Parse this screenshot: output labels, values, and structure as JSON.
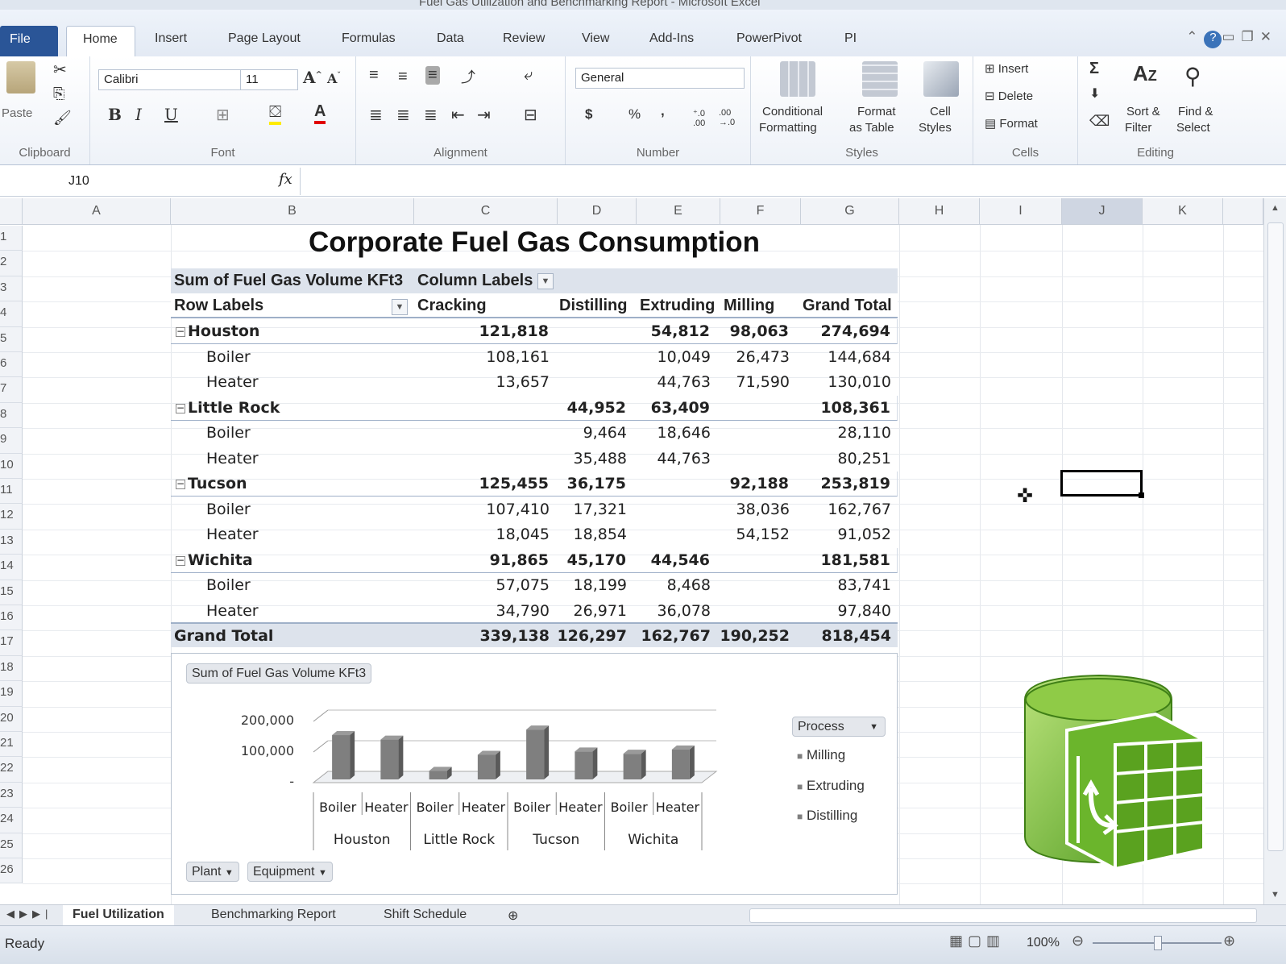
{
  "window": {
    "title": "Fuel Gas Utilization and Benchmarking Report - Microsoft Excel"
  },
  "ribbon_tabs": [
    "File",
    "Home",
    "Insert",
    "Page Layout",
    "Formulas",
    "Data",
    "Review",
    "View",
    "Add-Ins",
    "PowerPivot",
    "PI"
  ],
  "ribbon": {
    "clipboard": {
      "paste": "Paste",
      "label": "Clipboard"
    },
    "font": {
      "name": "Calibri",
      "size": "11",
      "label": "Font"
    },
    "alignment": {
      "label": "Alignment"
    },
    "number": {
      "format": "General",
      "currency": "$",
      "percent": "%",
      "comma": ",",
      "label": "Number"
    },
    "styles": {
      "conditional_1": "Conditional",
      "conditional_2": "Formatting",
      "format_table_1": "Format",
      "format_table_2": "as Table",
      "cell_styles_1": "Cell",
      "cell_styles_2": "Styles",
      "label": "Styles"
    },
    "cells": {
      "insert": "Insert",
      "delete": "Delete",
      "format": "Format",
      "label": "Cells"
    },
    "editing": {
      "sort_1": "Sort &",
      "sort_2": "Filter",
      "find_1": "Find &",
      "find_2": "Select",
      "label": "Editing"
    }
  },
  "formula_bar": {
    "name_box": "J10",
    "fx": "fx",
    "formula": ""
  },
  "columns": [
    "A",
    "B",
    "C",
    "D",
    "E",
    "F",
    "G",
    "H",
    "I",
    "J",
    "K"
  ],
  "rows": [
    "1",
    "2",
    "3",
    "4",
    "5",
    "6",
    "7",
    "8",
    "9",
    "10",
    "11",
    "12",
    "13",
    "14",
    "15",
    "16",
    "17",
    "18",
    "19",
    "20",
    "21",
    "22",
    "23",
    "24",
    "25",
    "26"
  ],
  "pivot": {
    "title": "Corporate Fuel Gas Consumption",
    "values_label": "Sum of Fuel Gas Volume KFt3",
    "column_labels": "Column Labels",
    "row_labels": "Row Labels",
    "headers": [
      "Cracking",
      "Distilling",
      "Extruding",
      "Milling",
      "Grand Total"
    ],
    "rows": [
      {
        "label": "Houston",
        "level": 0,
        "values": [
          "121,818",
          "",
          "54,812",
          "98,063",
          "274,694"
        ]
      },
      {
        "label": "Boiler",
        "level": 1,
        "values": [
          "108,161",
          "",
          "10,049",
          "26,473",
          "144,684"
        ]
      },
      {
        "label": "Heater",
        "level": 1,
        "values": [
          "13,657",
          "",
          "44,763",
          "71,590",
          "130,010"
        ]
      },
      {
        "label": "Little Rock",
        "level": 0,
        "values": [
          "",
          "44,952",
          "63,409",
          "",
          "108,361"
        ]
      },
      {
        "label": "Boiler",
        "level": 1,
        "values": [
          "",
          "9,464",
          "18,646",
          "",
          "28,110"
        ]
      },
      {
        "label": "Heater",
        "level": 1,
        "values": [
          "",
          "35,488",
          "44,763",
          "",
          "80,251"
        ]
      },
      {
        "label": "Tucson",
        "level": 0,
        "values": [
          "125,455",
          "36,175",
          "",
          "92,188",
          "253,819"
        ]
      },
      {
        "label": "Boiler",
        "level": 1,
        "values": [
          "107,410",
          "17,321",
          "",
          "38,036",
          "162,767"
        ]
      },
      {
        "label": "Heater",
        "level": 1,
        "values": [
          "18,045",
          "18,854",
          "",
          "54,152",
          "91,052"
        ]
      },
      {
        "label": "Wichita",
        "level": 0,
        "values": [
          "91,865",
          "45,170",
          "44,546",
          "",
          "181,581"
        ]
      },
      {
        "label": "Boiler",
        "level": 1,
        "values": [
          "57,075",
          "18,199",
          "8,468",
          "",
          "83,741"
        ]
      },
      {
        "label": "Heater",
        "level": 1,
        "values": [
          "34,790",
          "26,971",
          "36,078",
          "",
          "97,840"
        ]
      }
    ],
    "grand_total": {
      "label": "Grand Total",
      "values": [
        "339,138",
        "126,297",
        "162,767",
        "190,252",
        "818,454"
      ]
    }
  },
  "chart_data": {
    "type": "bar",
    "title": "Sum of Fuel Gas Volume KFt3",
    "categories": [
      "Boiler",
      "Heater",
      "Boiler",
      "Heater",
      "Boiler",
      "Heater",
      "Boiler",
      "Heater"
    ],
    "groups": [
      "Houston",
      "Little Rock",
      "Tucson",
      "Wichita"
    ],
    "values": [
      144684,
      130010,
      28110,
      80251,
      162767,
      91052,
      83741,
      97840
    ],
    "y_ticks": [
      "200,000",
      "100,000",
      "-"
    ],
    "ylim": [
      0,
      200000
    ],
    "legend_title": "Process",
    "legend": [
      "Milling",
      "Extruding",
      "Distilling"
    ],
    "field_buttons": [
      "Plant",
      "Equipment"
    ],
    "bar_color": "#7f7f7f"
  },
  "sheets": [
    "Fuel Utilization",
    "Benchmarking Report",
    "Shift Schedule"
  ],
  "status": {
    "ready": "Ready",
    "zoom": "100%"
  },
  "colors": {
    "accent": "#2a5597",
    "logo_green": "#6bb52c"
  }
}
